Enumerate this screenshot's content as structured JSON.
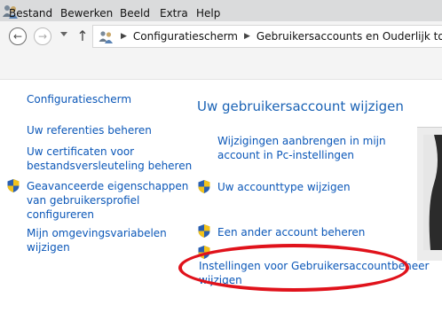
{
  "address": {
    "path": [
      "Configuratiescherm",
      "Gebruikersaccounts en Ouderlijk toezicht"
    ]
  },
  "menu": [
    "Bestand",
    "Bewerken",
    "Beeld",
    "Extra",
    "Help"
  ],
  "sidebar": {
    "home": "Configuratiescherm",
    "links": [
      {
        "line1": "Uw referenties beheren",
        "line2": "",
        "line3": "",
        "shield": false
      },
      {
        "line1": "Uw certificaten voor",
        "line2": "bestandsversleuteling beheren",
        "line3": "",
        "shield": false
      },
      {
        "line1": "Geavanceerde eigenschappen",
        "line2": "van gebruikersprofiel",
        "line3": "configureren",
        "shield": true
      },
      {
        "line1": "Mijn omgevingsvariabelen",
        "line2": "wijzigen",
        "line3": "",
        "shield": false
      }
    ]
  },
  "main": {
    "heading": "Uw gebruikersaccount wijzigen",
    "links": [
      {
        "line1": "Wijzigingen aanbrengen in mijn",
        "line2": "account in Pc-instellingen",
        "shield": false
      },
      {
        "line1": "Uw accounttype wijzigen",
        "line2": "",
        "shield": true
      },
      {
        "line1": "Een ander account beheren",
        "line2": "",
        "shield": true
      },
      {
        "line1": "Instellingen voor Gebruikersaccountbeheer",
        "line2": "wijzigen",
        "shield": true
      }
    ]
  },
  "colors": {
    "link": "#0b57b8",
    "heading": "#1b63b5",
    "annotation": "#e0121b"
  }
}
